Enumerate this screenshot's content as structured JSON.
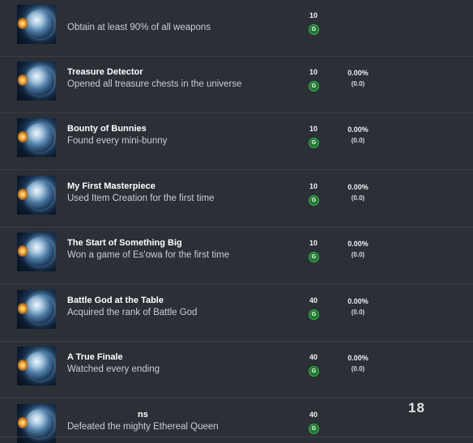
{
  "achievements": [
    {
      "title": "",
      "description": "Obtain at least 90% of all weapons",
      "score": "10",
      "gamerscore_symbol": "G",
      "percent": "",
      "percent_sub": ""
    },
    {
      "title": "Treasure Detector",
      "description": "Opened all treasure chests in the universe",
      "score": "10",
      "gamerscore_symbol": "G",
      "percent": "0.00%",
      "percent_sub": "(0.0)"
    },
    {
      "title": "Bounty of Bunnies",
      "description": "Found every mini-bunny",
      "score": "10",
      "gamerscore_symbol": "G",
      "percent": "0.00%",
      "percent_sub": "(0.0)"
    },
    {
      "title": "My First Masterpiece",
      "description": "Used Item Creation for the first time",
      "score": "10",
      "gamerscore_symbol": "G",
      "percent": "0.00%",
      "percent_sub": "(0.0)"
    },
    {
      "title": "The Start of Something Big",
      "description": "Won a game of Es'owa for the first time",
      "score": "10",
      "gamerscore_symbol": "G",
      "percent": "0.00%",
      "percent_sub": "(0.0)"
    },
    {
      "title": "Battle God at the Table",
      "description": "Acquired the rank of Battle God",
      "score": "40",
      "gamerscore_symbol": "G",
      "percent": "0.00%",
      "percent_sub": "(0.0)"
    },
    {
      "title": "A True Finale",
      "description": "Watched every ending",
      "score": "40",
      "gamerscore_symbol": "G",
      "percent": "0.00%",
      "percent_sub": "(0.0)"
    },
    {
      "title": "ns",
      "description": "Defeated the mighty Ethereal Queen",
      "score": "40",
      "gamerscore_symbol": "G",
      "percent": "",
      "percent_sub": ""
    }
  ],
  "watermark": {
    "text": "18"
  },
  "colors": {
    "background": "#2b2f36",
    "gamerscore_badge": "#1e7a2e",
    "divider": "#3a3f47"
  },
  "icons": {
    "achievement_thumbnail": "planet-achievement-icon"
  }
}
